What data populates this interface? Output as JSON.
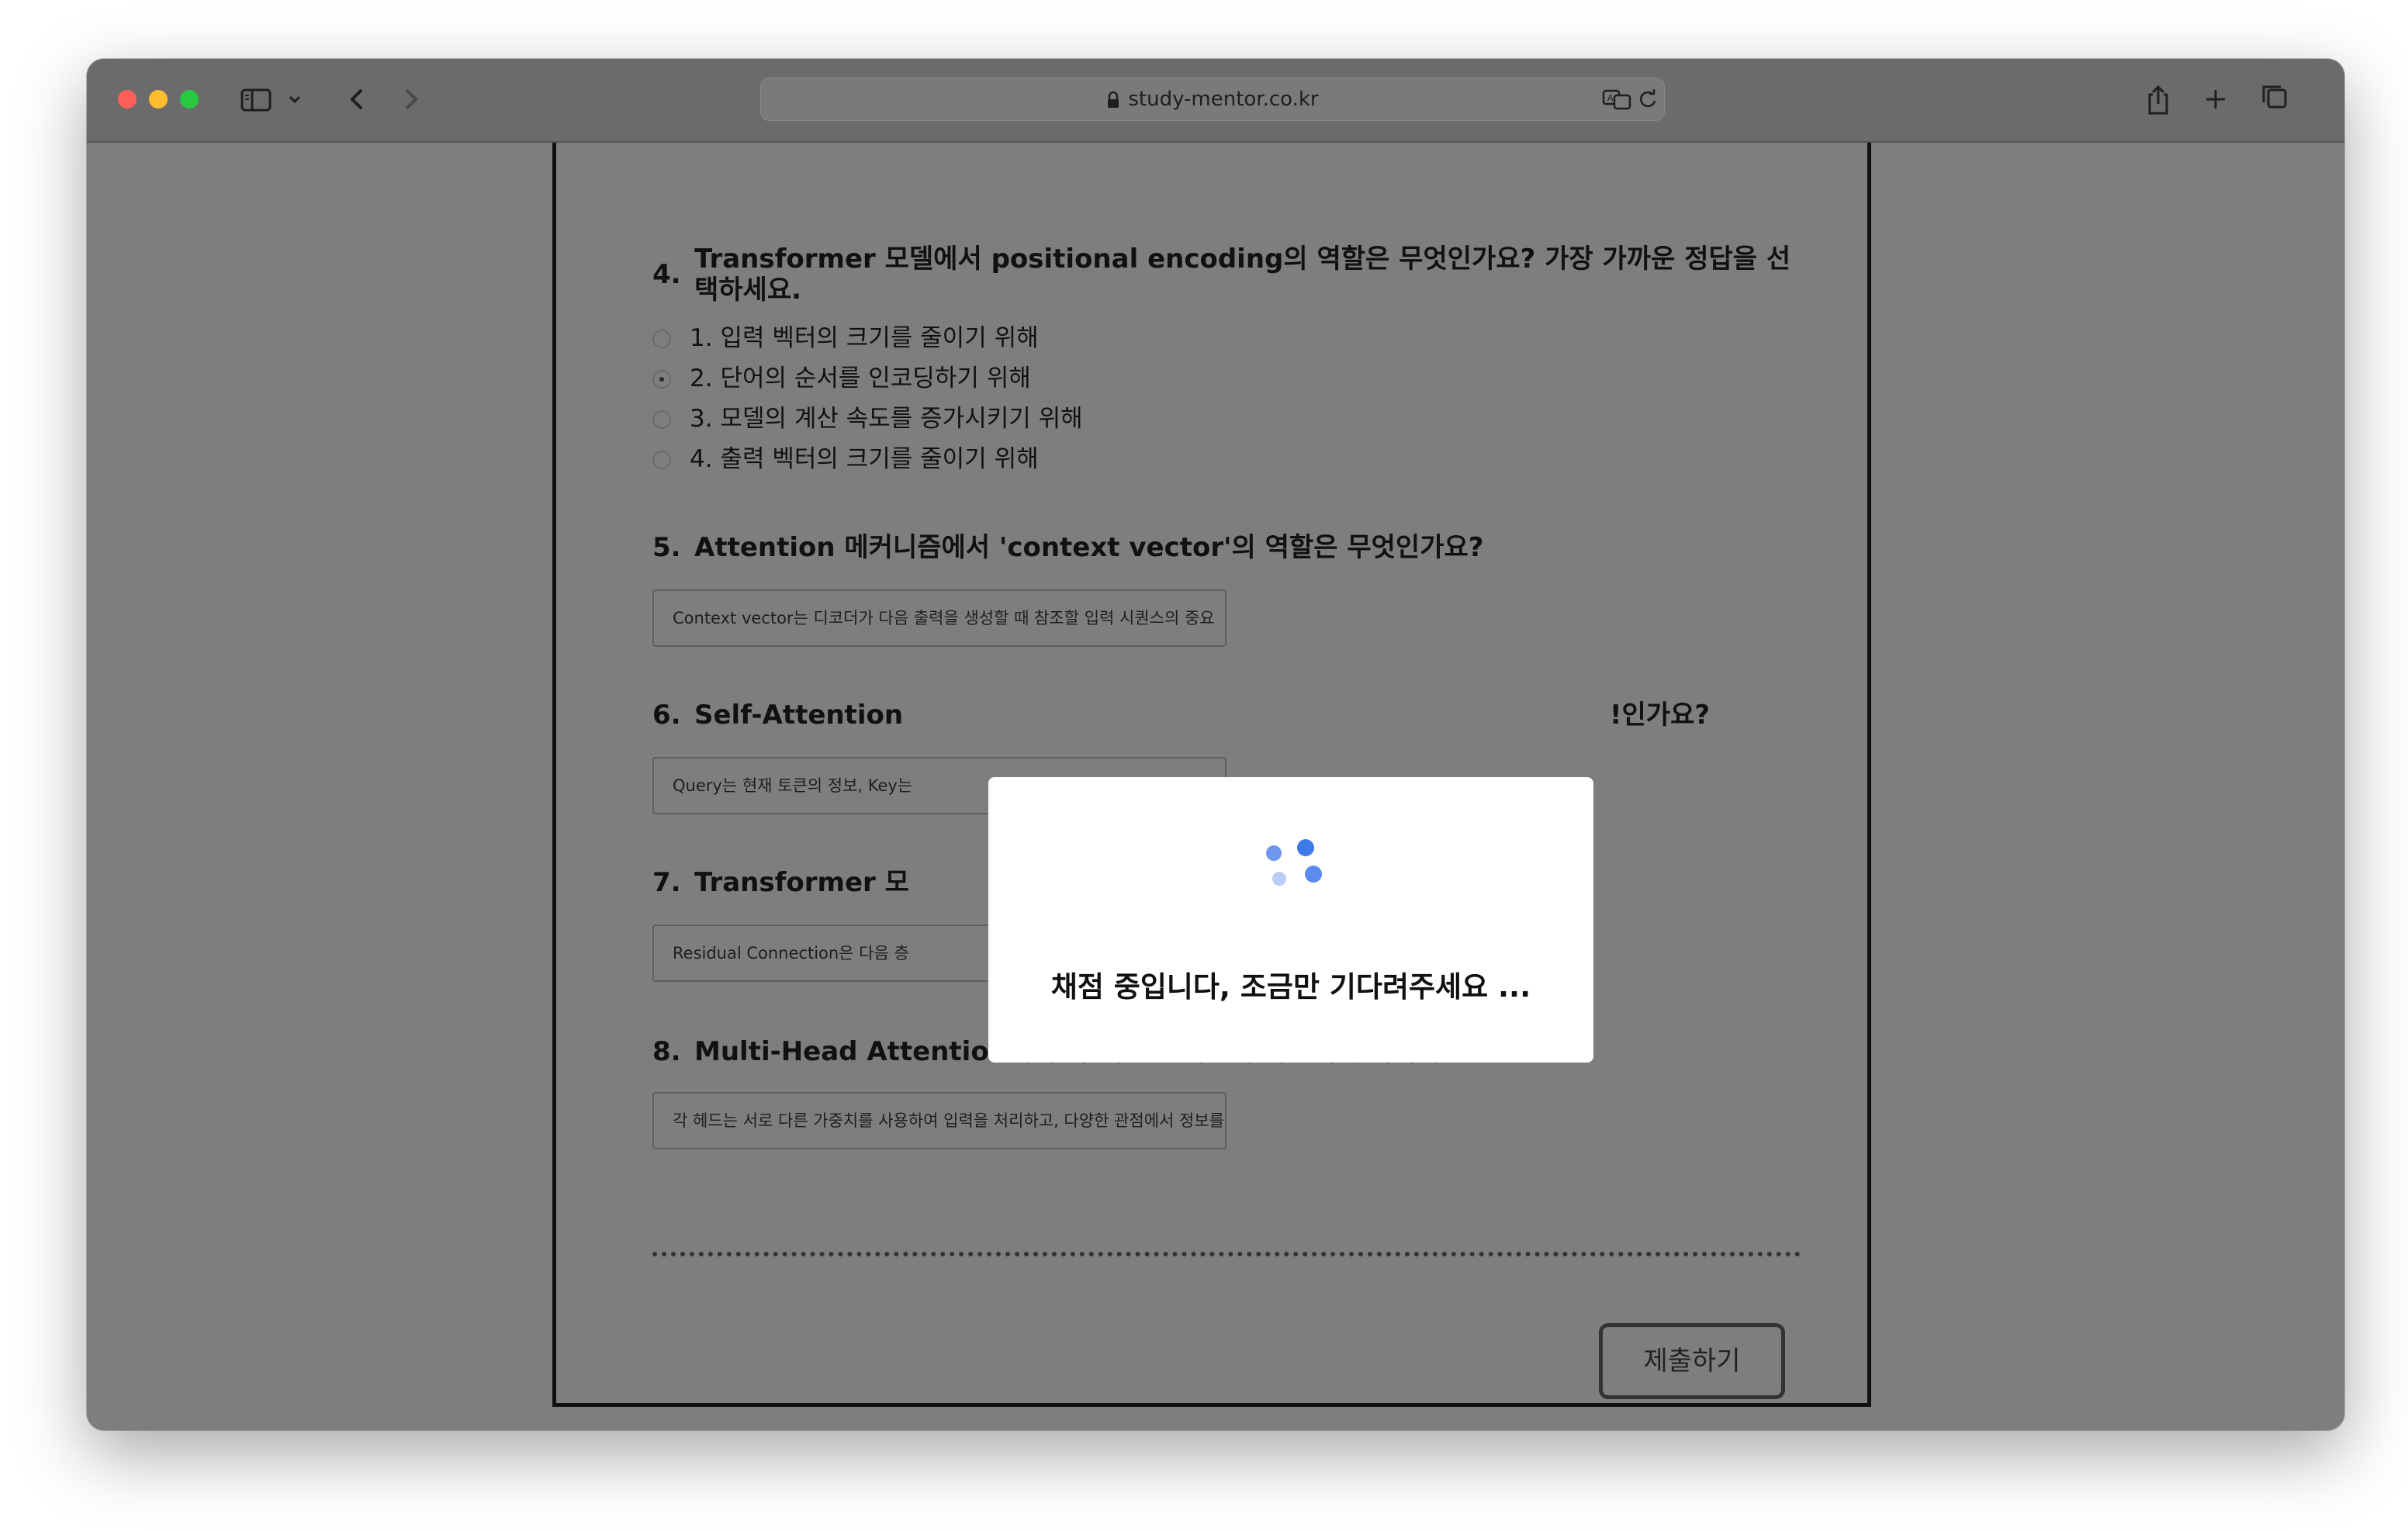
{
  "browser": {
    "url": "study-mentor.co.kr"
  },
  "questions": [
    {
      "number": "4.",
      "text_line1": "Transformer 모델에서 positional encoding의 역할은 무엇인가요? 가장 가까운 정답을 선",
      "text_line2": "택하세요.",
      "options": [
        {
          "label": "1. 입력 벡터의 크기를 줄이기 위해",
          "selected": false
        },
        {
          "label": "2. 단어의 순서를 인코딩하기 위해",
          "selected": true
        },
        {
          "label": "3. 모델의 계산 속도를 증가시키기 위해",
          "selected": false
        },
        {
          "label": "4. 출력 벡터의 크기를 줄이기 위해",
          "selected": false
        }
      ]
    },
    {
      "number": "5.",
      "text": "Attention 메커니즘에서 'context vector'의 역할은 무엇인가요?",
      "answer": "Context vector는 디코더가 다음 출력을 생성할 때 참조할 입력 시퀀스의 중요"
    },
    {
      "number": "6.",
      "text_visible_left": "Self-Attention ",
      "text_visible_right": "!인가요?",
      "answer": "Query는 현재 토큰의 정보, Key는"
    },
    {
      "number": "7.",
      "text_visible_left": "Transformer 모",
      "text_visible_right": "?",
      "answer": "Residual Connection은 다음 층"
    },
    {
      "number": "8.",
      "text": "Multi-Head Attention에서 각 헤드는 어떻게 다르게 동작하나요?",
      "answer": "각 헤드는 서로 다른 가중치를 사용하여 입력을 처리하고, 다양한 관점에서 정보를"
    }
  ],
  "submit_label": "제출하기",
  "modal": {
    "message": "채점 중입니다, 조금만 기다려주세요 ..."
  }
}
